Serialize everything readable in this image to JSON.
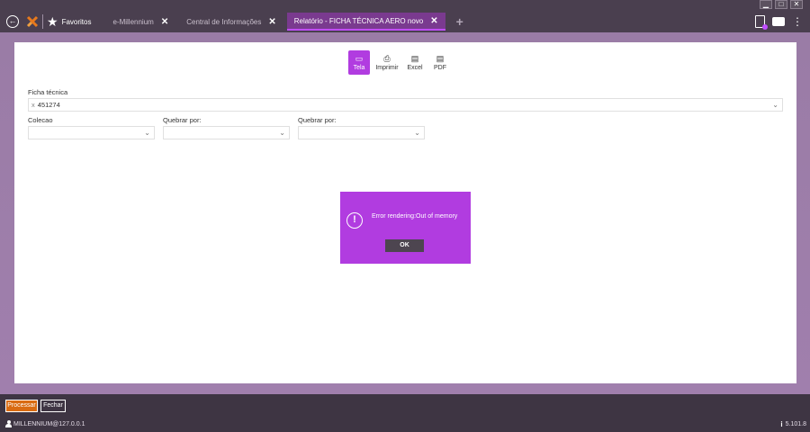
{
  "window": {
    "minimize": "▁",
    "maximize": "□",
    "close": "✕"
  },
  "topbar": {
    "favorites_label": "Favoritos",
    "tabs": [
      {
        "label": "e-Millennium",
        "close": "✕"
      },
      {
        "label": "Central de Informações",
        "close": "✕"
      },
      {
        "label": "Relatório - FICHA TÉCNICA AERO novo",
        "close": "✕"
      }
    ],
    "add_tab": "+"
  },
  "report_toolbar": {
    "tela": "Tela",
    "imprimir": "Imprimir",
    "excel": "Excel",
    "pdf": "PDF"
  },
  "form": {
    "ficha_tecnica_label": "Ficha técnica",
    "ficha_tecnica_chip": "451274",
    "chip_remove": "x",
    "colecao_label": "Colecao",
    "quebrar1_label": "Quebrar por:",
    "quebrar2_label": "Quebrar por:"
  },
  "dialog": {
    "message": "Error rendering:Out of memory",
    "ok_label": "OK"
  },
  "footer": {
    "processar": "Processar",
    "fechar": "Fechar",
    "user": "MILLENNIUM@127.0.0.1",
    "version": "5.101.8"
  },
  "colors": {
    "accent": "#b13ce0",
    "orange": "#d96b12",
    "frame": "#4a3f4f"
  }
}
